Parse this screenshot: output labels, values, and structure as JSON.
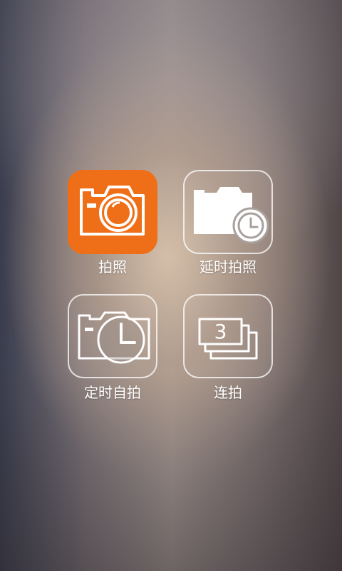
{
  "menu": {
    "items": [
      {
        "label": "拍照",
        "icon": "camera-icon",
        "state": "selected"
      },
      {
        "label": "延时拍照",
        "icon": "camera-clock-icon",
        "state": "normal"
      },
      {
        "label": "定时自拍",
        "icon": "self-timer-icon",
        "state": "normal"
      },
      {
        "label": "连拍",
        "icon": "burst-icon",
        "badge": "3",
        "state": "normal"
      }
    ]
  },
  "colors": {
    "accent": "#ee6f17",
    "outline": "#ffffff"
  }
}
